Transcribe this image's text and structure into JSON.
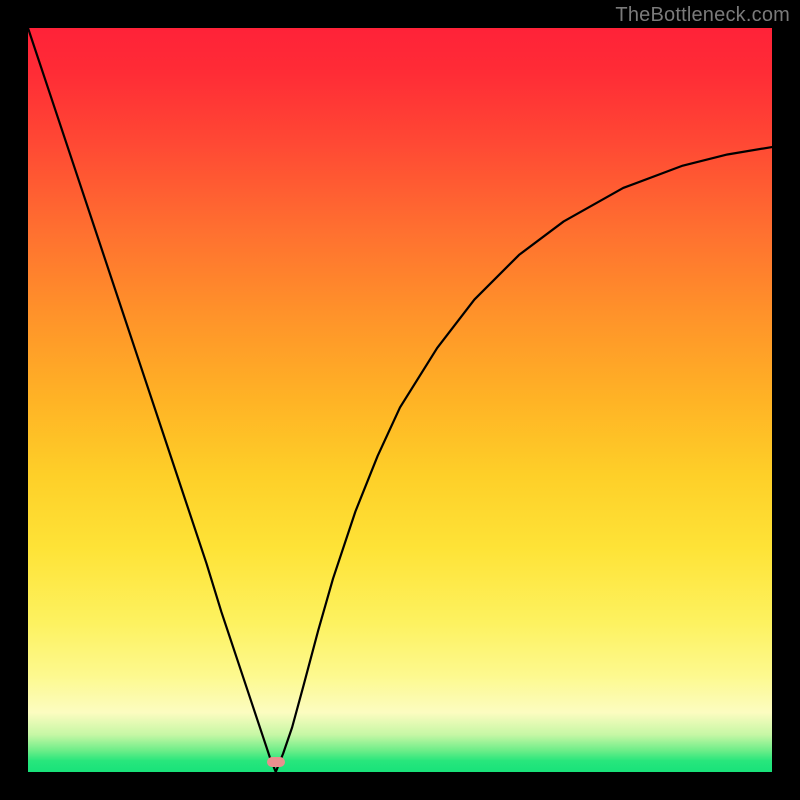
{
  "watermark": "TheBottleneck.com",
  "marker": {
    "x_frac": 0.333,
    "y_frac": 0.987
  },
  "chart_data": {
    "type": "line",
    "title": "",
    "xlabel": "",
    "ylabel": "",
    "xlim": [
      0,
      1
    ],
    "ylim": [
      0,
      1
    ],
    "grid": false,
    "series": [
      {
        "name": "curve",
        "x": [
          0.0,
          0.03,
          0.06,
          0.09,
          0.12,
          0.15,
          0.18,
          0.21,
          0.24,
          0.26,
          0.28,
          0.3,
          0.315,
          0.325,
          0.333,
          0.343,
          0.355,
          0.37,
          0.39,
          0.41,
          0.44,
          0.47,
          0.5,
          0.55,
          0.6,
          0.66,
          0.72,
          0.8,
          0.88,
          0.94,
          1.0
        ],
        "y": [
          1.0,
          0.91,
          0.82,
          0.73,
          0.64,
          0.55,
          0.46,
          0.37,
          0.28,
          0.215,
          0.155,
          0.095,
          0.05,
          0.02,
          0.0,
          0.025,
          0.06,
          0.115,
          0.19,
          0.26,
          0.35,
          0.425,
          0.49,
          0.57,
          0.635,
          0.695,
          0.74,
          0.785,
          0.815,
          0.83,
          0.84
        ]
      }
    ],
    "markers": [
      {
        "name": "highlight",
        "x": 0.333,
        "y": 0.013,
        "color": "#ea8f8e"
      }
    ],
    "background_gradient": {
      "direction": "top-to-bottom",
      "stops": [
        {
          "pos": 0.0,
          "color": "#ff2238"
        },
        {
          "pos": 0.5,
          "color": "#ffb325"
        },
        {
          "pos": 0.8,
          "color": "#fdf260"
        },
        {
          "pos": 0.97,
          "color": "#72ee8a"
        },
        {
          "pos": 1.0,
          "color": "#18e27a"
        }
      ]
    }
  }
}
